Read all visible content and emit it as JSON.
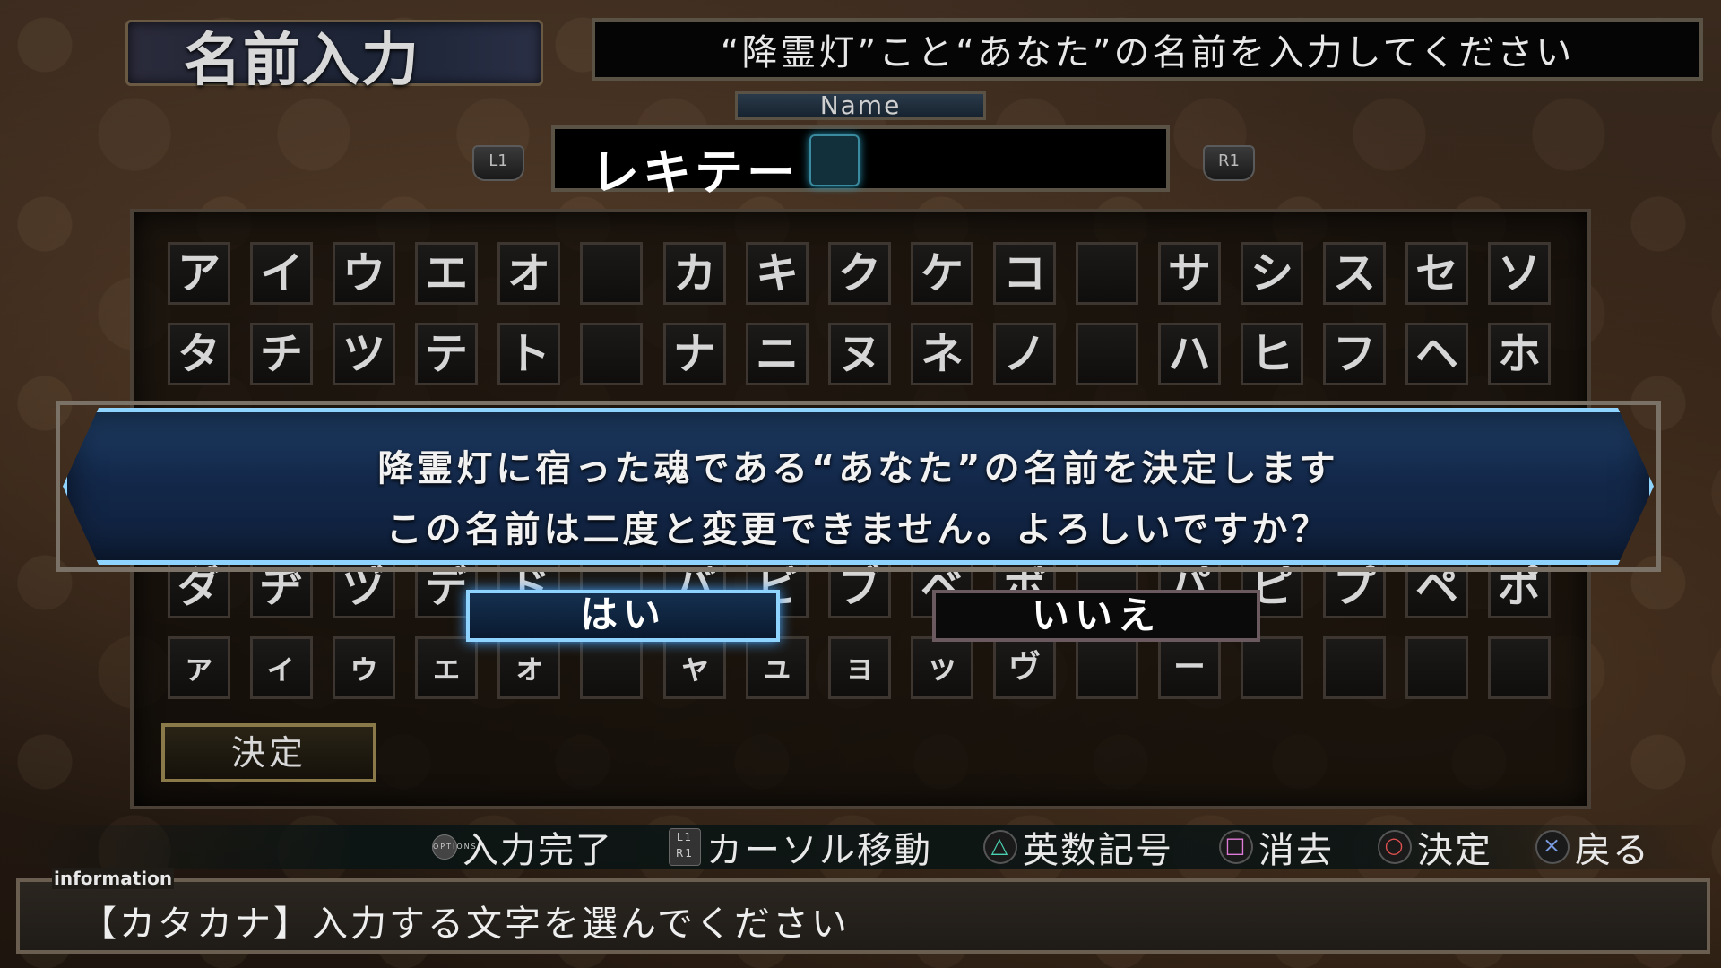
{
  "header": {
    "title": "名前入力",
    "prompt": "“降霊灯”こと“あなた”の名前を入力してください"
  },
  "name_entry": {
    "label": "Name",
    "value": "レキテー",
    "left_button": "L1",
    "right_button": "R1"
  },
  "keyboard": {
    "rows": [
      [
        "ア",
        "イ",
        "ウ",
        "エ",
        "オ",
        "",
        "カ",
        "キ",
        "ク",
        "ケ",
        "コ",
        "",
        "サ",
        "シ",
        "ス",
        "セ",
        "ソ"
      ],
      [
        "タ",
        "チ",
        "ツ",
        "テ",
        "ト",
        "",
        "ナ",
        "ニ",
        "ヌ",
        "ネ",
        "ノ",
        "",
        "ハ",
        "ヒ",
        "フ",
        "ヘ",
        "ホ"
      ],
      [
        "ダ",
        "ヂ",
        "ヅ",
        "デ",
        "ド",
        "",
        "バ",
        "ビ",
        "ブ",
        "ベ",
        "ボ",
        "",
        "パ",
        "ピ",
        "プ",
        "ペ",
        "ポ"
      ],
      [
        "ァ",
        "ィ",
        "ゥ",
        "ェ",
        "ォ",
        "",
        "ャ",
        "ュ",
        "ョ",
        "ッ",
        "ヴ",
        "",
        "ー",
        "",
        "",
        "",
        ""
      ]
    ],
    "confirm_label": "決定"
  },
  "dialog": {
    "line1": "降霊灯に宿った魂である“あなた”の名前を決定します",
    "line2": "この名前は二度と変更できません。よろしいですか？",
    "yes": "はい",
    "no": "いいえ",
    "selected": "はい"
  },
  "controls": {
    "options_icon": "OPTIONS",
    "finish": "入力完了",
    "cursor_move": "カーソル移動",
    "alnum": "英数記号",
    "delete": "消去",
    "decide": "決定",
    "back": "戻る"
  },
  "information": {
    "label": "information",
    "text": "【カタカナ】入力する文字を選んでください"
  },
  "colors": {
    "accent_blue": "#8fd4ff",
    "frame": "#5a5245"
  }
}
